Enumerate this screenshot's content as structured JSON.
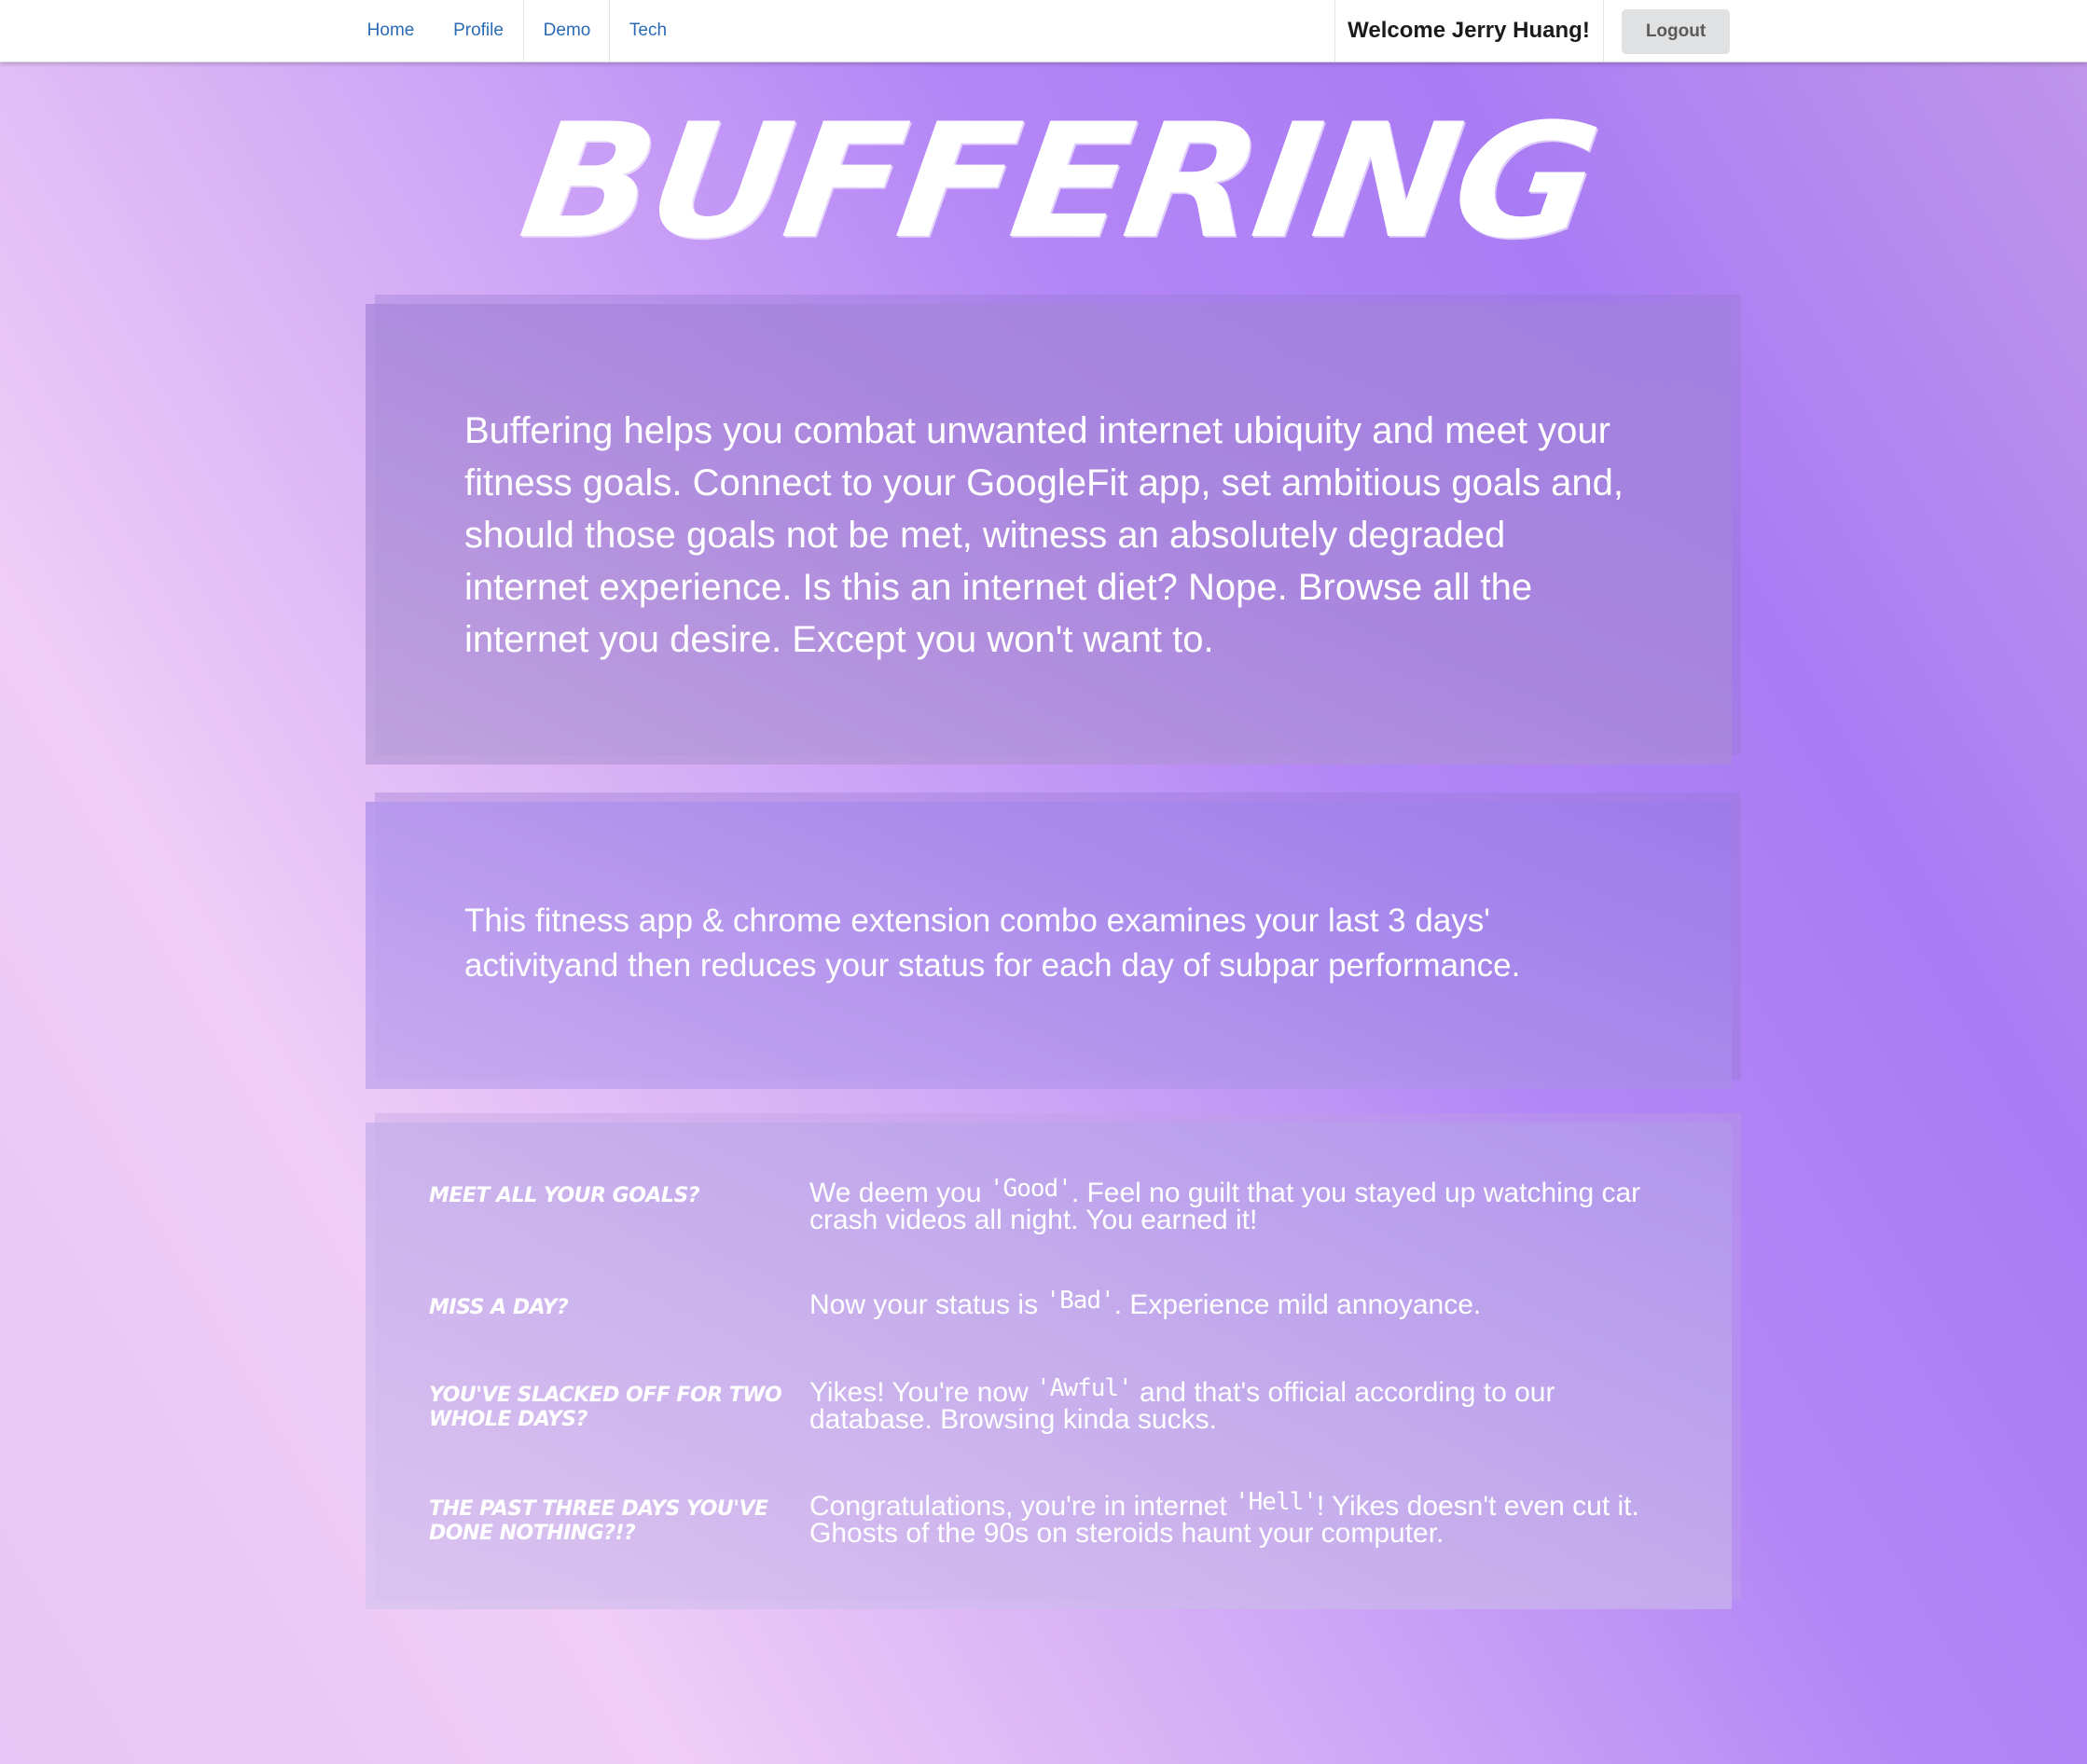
{
  "nav": {
    "home": "Home",
    "profile": "Profile",
    "demo": "Demo",
    "tech": "Tech",
    "welcome": "Welcome Jerry Huang!",
    "logout": "Logout"
  },
  "brand": {
    "title": "BUFFERING"
  },
  "intro": {
    "text": "Buffering helps you combat unwanted internet ubiquity and meet your fitness goals. Connect to your GoogleFit app, set ambitious goals and, should those goals not be met, witness an absolutely degraded internet experience. Is this an internet diet? Nope. Browse all the internet you desire. Except you won't want to."
  },
  "summary": {
    "text": "This fitness app & chrome extension combo examines your last 3 days' activityand then reduces your status for each day of subpar performance."
  },
  "statuses": [
    {
      "question": "Meet all your goals?",
      "before": "We deem you ",
      "status": "'Good'",
      "after": ". Feel no guilt that you stayed up watching car crash videos all night. You earned it!"
    },
    {
      "question": "Miss a day?",
      "before": "Now your status is ",
      "status": "'Bad'",
      "after": ". Experience mild annoyance."
    },
    {
      "question": "You've slacked off for two whole days?",
      "before": "Yikes! You're now ",
      "status": "'Awful'",
      "after": " and that's official according to our database. Browsing kinda sucks."
    },
    {
      "question": "The past three days you've done nothing?!?",
      "before": "Congratulations, you're in internet ",
      "status": "'Hell'",
      "after": "! Yikes doesn't even cut it. Ghosts of the 90s on steroids haunt your computer."
    }
  ],
  "colors": {
    "nav_link": "#2a6bb3",
    "background_pink": "#f0cdf6",
    "background_purple": "#aa7cf4"
  }
}
